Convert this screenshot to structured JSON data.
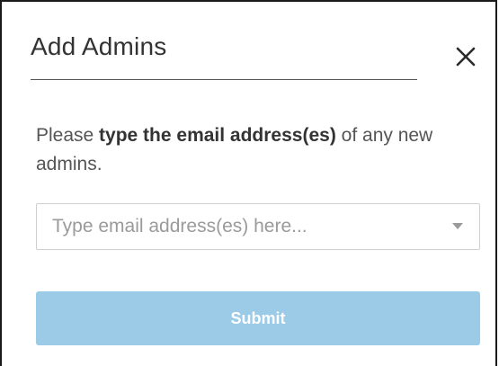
{
  "dialog": {
    "title": "Add Admins",
    "close_icon": "close-icon",
    "instructions": {
      "prefix": "Please ",
      "emphasis": "type the email address(es)",
      "suffix": " of any new admins."
    },
    "email_input": {
      "placeholder": "Type email address(es) here...",
      "value": "",
      "dropdown_icon": "chevron-down-icon"
    },
    "submit_label": "Submit"
  },
  "colors": {
    "submit_background": "#9ccbe7",
    "text_primary": "#333333",
    "text_secondary": "#555555",
    "placeholder": "#9a9a9a",
    "border": "#cfcfcf"
  }
}
